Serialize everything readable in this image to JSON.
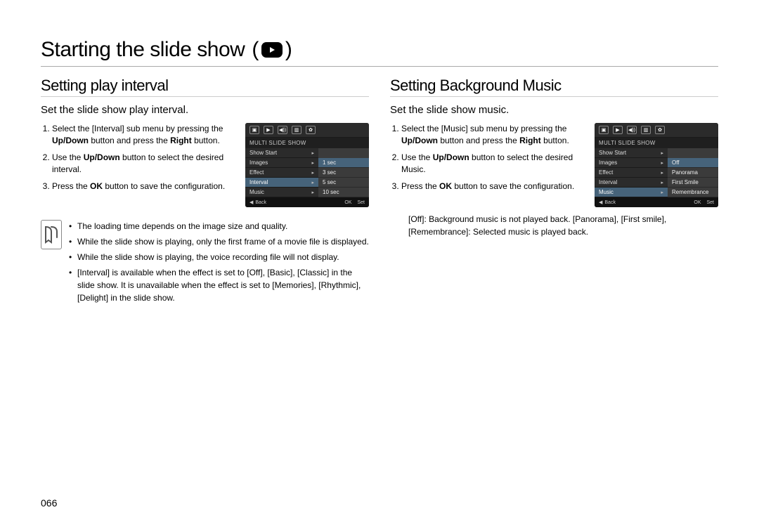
{
  "page": {
    "title": "Starting the slide show",
    "page_number": "066"
  },
  "left": {
    "heading": "Setting play interval",
    "lead": "Set the slide show play interval.",
    "steps": {
      "s1a": "Select the [Interval] sub menu by pressing the ",
      "s1b": "Up/Down",
      "s1c": " button and press the ",
      "s1d": "Right",
      "s1e": " button.",
      "s2a": "Use the ",
      "s2b": "Up/Down",
      "s2c": " button to select the desired interval.",
      "s3a": "Press the ",
      "s3b": "OK",
      "s3c": " button to save the configuration."
    },
    "lcd": {
      "title": "MULTI SLIDE SHOW",
      "menu": [
        "Show Start",
        "Images",
        "Effect",
        "Interval",
        "Music"
      ],
      "selected_index": 3,
      "right_options": [
        "1 sec",
        "3 sec",
        "5 sec",
        "10 sec"
      ],
      "right_selected": 0,
      "bot_back": "Back",
      "bot_ok": "OK",
      "bot_set": "Set"
    },
    "notes": [
      "The loading time depends on the image size and quality.",
      "While the slide show is playing, only the first frame of a movie file is displayed.",
      "While the slide show is playing, the voice recording file will not display.",
      "[Interval] is available when the effect is set to [Off], [Basic], [Classic] in the slide show. It is unavailable when the effect is set to [Memories], [Rhythmic], [Delight] in the slide show."
    ]
  },
  "right": {
    "heading": "Setting Background Music",
    "lead": "Set the slide show music.",
    "steps": {
      "s1a": "Select the [Music] sub menu by pressing the ",
      "s1b": "Up/Down",
      "s1c": " button and press the ",
      "s1d": "Right",
      "s1e": " button.",
      "s2a": "Use the ",
      "s2b": "Up/Down",
      "s2c": " button to select the desired Music.",
      "s3a": "Press the ",
      "s3b": "OK",
      "s3c": " button to save the configuration."
    },
    "lcd": {
      "title": "MULTI SLIDE SHOW",
      "menu": [
        "Show Start",
        "Images",
        "Effect",
        "Interval",
        "Music"
      ],
      "selected_index": 4,
      "right_options": [
        "Off",
        "Panorama",
        "First Smile",
        "Remembrance"
      ],
      "right_selected": 0,
      "bot_back": "Back",
      "bot_ok": "OK",
      "bot_set": "Set"
    },
    "extra": "[Off]: Background music is not played back. [Panorama], [First smile], [Remembrance]: Selected music is played back."
  }
}
